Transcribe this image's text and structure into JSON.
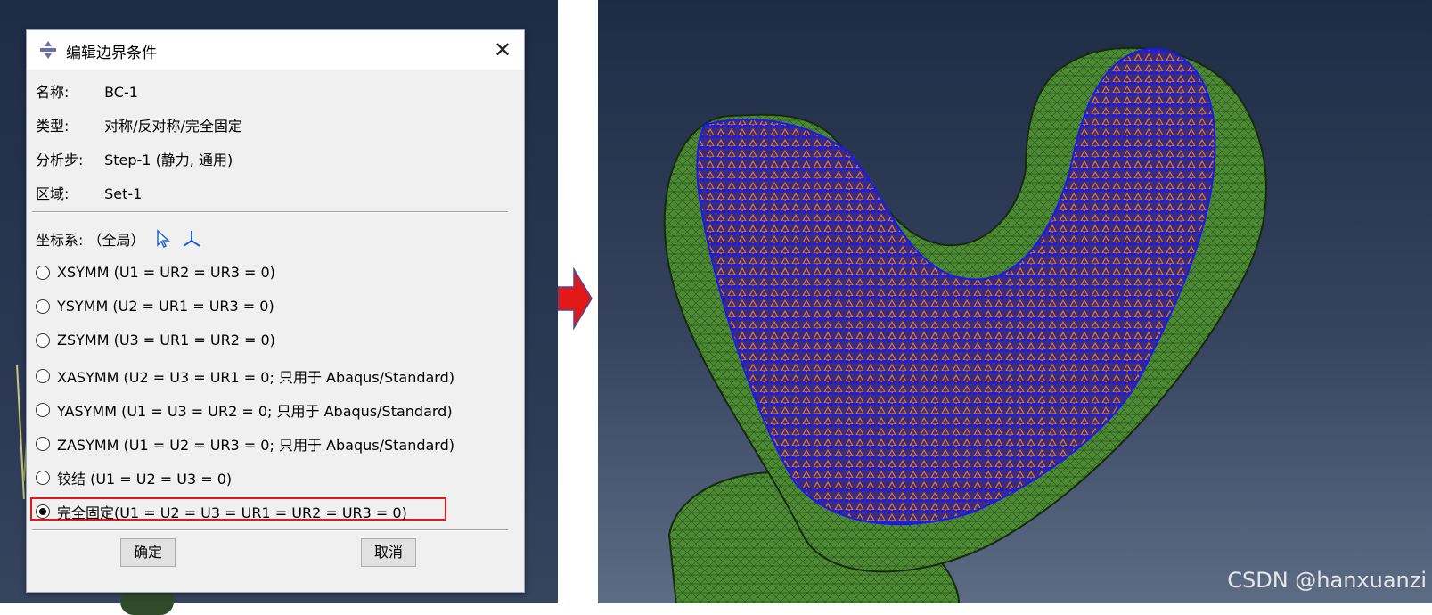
{
  "dialog": {
    "title": "编辑边界条件",
    "fields": [
      {
        "label": "名称:",
        "value": "BC-1"
      },
      {
        "label": "类型:",
        "value": "对称/反对称/完全固定"
      },
      {
        "label": "分析步:",
        "value": "Step-1 (静力, 通用)"
      },
      {
        "label": "区域:",
        "value": "Set-1"
      }
    ],
    "csys_label": "坐标系: （全局）",
    "options": [
      {
        "label": "XSYMM (U1 = UR2 = UR3 = 0)",
        "checked": false
      },
      {
        "label": "YSYMM (U2 = UR1 = UR3 = 0)",
        "checked": false
      },
      {
        "label": "ZSYMM (U3 = UR1 = UR2 = 0)",
        "checked": false
      },
      {
        "label": "XASYMM (U2 = U3 = UR1 = 0; 只用于 Abaqus/Standard)",
        "checked": false
      },
      {
        "label": "YASYMM (U1 = U3 = UR2 = 0; 只用于 Abaqus/Standard)",
        "checked": false
      },
      {
        "label": "ZASYMM (U1 = U2 = UR3 = 0; 只用于 Abaqus/Standard)",
        "checked": false
      },
      {
        "label": "铰结 (U1 = U2 = U3 = 0)",
        "checked": false
      },
      {
        "label": "完全固定(U1 = U2 = U3 = UR1 = UR2 = UR3 = 0)",
        "checked": true
      }
    ],
    "ok_label": "确定",
    "cancel_label": "取消"
  },
  "viewport": {
    "watermark": "CSDN @hanxuanzi",
    "colors": {
      "mesh": "#3f7a2a",
      "constraint_orange": "#e07a2a",
      "constraint_blue": "#1a1aee",
      "arrow": "#e01818"
    }
  }
}
